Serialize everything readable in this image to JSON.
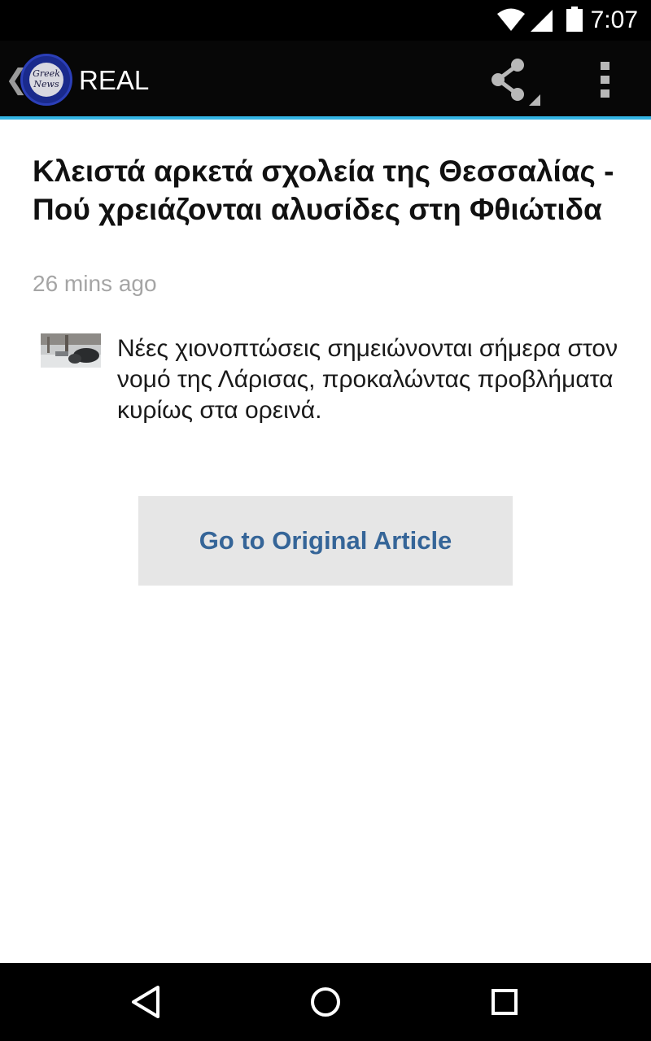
{
  "status_bar": {
    "time": "7:07",
    "icons": [
      "wifi-icon",
      "signal-icon",
      "battery-icon"
    ]
  },
  "action_bar": {
    "back_glyph": "❮",
    "logo_text_line1": "Greek",
    "logo_text_line2": "News",
    "title": "REAL",
    "icons": [
      "share-icon",
      "overflow-menu-icon"
    ],
    "accent_color": "#33b5e5"
  },
  "article": {
    "headline": "Κλειστά αρκετά σχολεία της Θεσσαλίας - Πού χρειάζονται αλυσίδες στη Φθιώτιδα",
    "timestamp": "26 mins ago",
    "summary": "Νέες χιονοπτώσεις σημειώνονται σήμερα στον νομό της Λάρισας, προκαλώντας προβλήματα κυρίως στα ορεινά.",
    "button_label": "Go to Original Article",
    "button_color": "#356598"
  },
  "nav_bar": {
    "icons": [
      "back-icon",
      "home-icon",
      "recents-icon"
    ]
  }
}
